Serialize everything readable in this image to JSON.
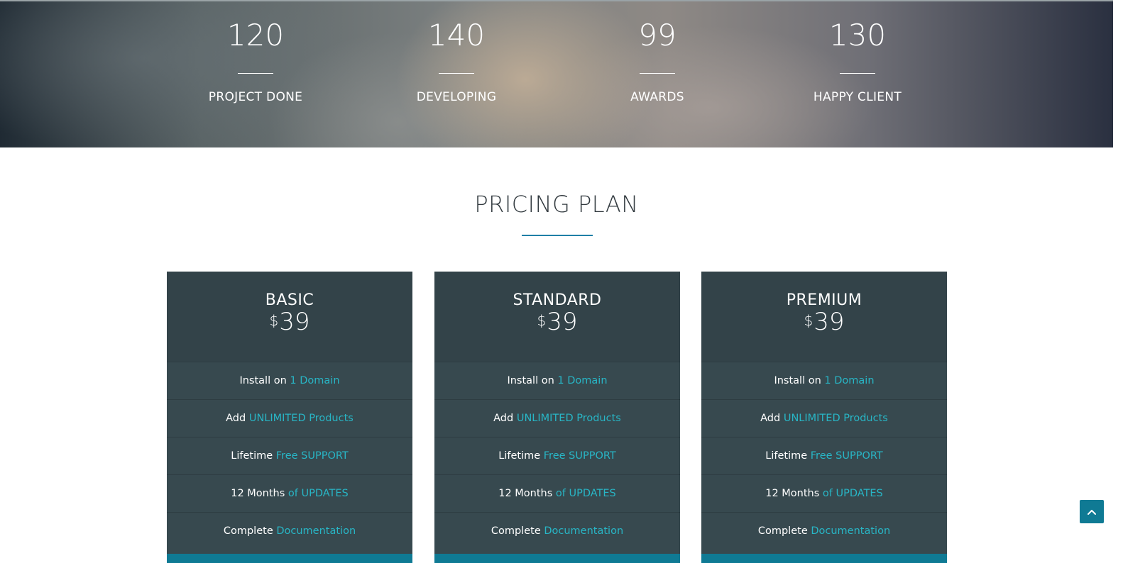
{
  "stats": [
    {
      "number": "120",
      "label": "PROJECT DONE"
    },
    {
      "number": "140",
      "label": "DEVELOPING"
    },
    {
      "number": "99",
      "label": "AWARDS"
    },
    {
      "number": "130",
      "label": "HAPPY CLIENT"
    }
  ],
  "pricing": {
    "title": "PRICING PLAN",
    "plans": [
      {
        "name": "BASIC",
        "currency": "$",
        "price": "39",
        "features": [
          {
            "text": "Install on",
            "highlight": "1 Domain"
          },
          {
            "text": "Add",
            "highlight": "UNLIMITED Products"
          },
          {
            "text": "Lifetime",
            "highlight": "Free SUPPORT"
          },
          {
            "text": "12 Months",
            "highlight": "of UPDATES"
          },
          {
            "text": "Complete",
            "highlight": "Documentation"
          }
        ]
      },
      {
        "name": "STANDARD",
        "currency": "$",
        "price": "39",
        "features": [
          {
            "text": "Install on",
            "highlight": "1 Domain"
          },
          {
            "text": "Add",
            "highlight": "UNLIMITED Products"
          },
          {
            "text": "Lifetime",
            "highlight": "Free SUPPORT"
          },
          {
            "text": "12 Months",
            "highlight": "of UPDATES"
          },
          {
            "text": "Complete",
            "highlight": "Documentation"
          }
        ]
      },
      {
        "name": "PREMIUM",
        "currency": "$",
        "price": "39",
        "features": [
          {
            "text": "Install on",
            "highlight": "1 Domain"
          },
          {
            "text": "Add",
            "highlight": "UNLIMITED Products"
          },
          {
            "text": "Lifetime",
            "highlight": "Free SUPPORT"
          },
          {
            "text": "12 Months",
            "highlight": "of UPDATES"
          },
          {
            "text": "Complete",
            "highlight": "Documentation"
          }
        ]
      }
    ]
  },
  "back_to_top": {
    "icon": "chevron-up-icon"
  },
  "colors": {
    "accent": "#28b6c6",
    "button": "#0f7a94",
    "card": "#37494f",
    "title_rule": "#1f7fa6"
  }
}
